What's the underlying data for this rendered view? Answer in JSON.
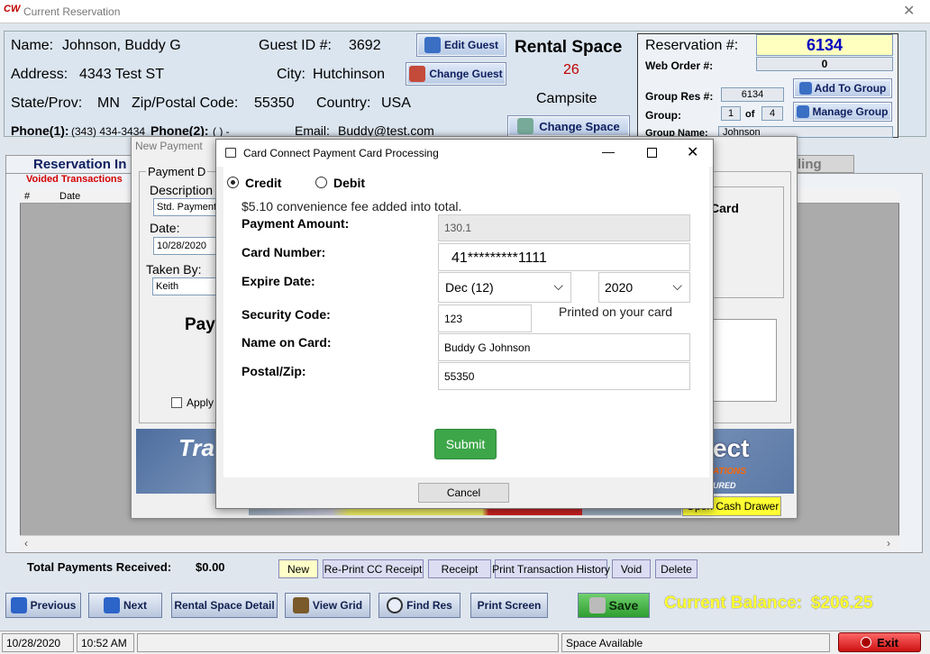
{
  "app": {
    "title": "Current Reservation",
    "logo": "CW"
  },
  "guest": {
    "name_label": "Name:",
    "name_value": "Johnson, Buddy G",
    "guest_id_label": "Guest ID #:",
    "guest_id_value": "3692",
    "address_label": "Address:",
    "address_value": "4343 Test ST",
    "city_label": "City:",
    "city_value": "Hutchinson",
    "state_label": "State/Prov:",
    "state_value": "MN",
    "zip_label": "Zip/Postal Code:",
    "zip_value": "55350",
    "country_label": "Country:",
    "country_value": "USA",
    "phone1_label": "Phone(1):",
    "phone1_value": "(343) 434-3434",
    "phone2_label": "Phone(2):",
    "phone2_value": "(   )      -",
    "email_label": "Email:",
    "email_value": "Buddy@test.com",
    "edit_guest": "Edit Guest",
    "change_guest": "Change Guest"
  },
  "rental": {
    "label": "Rental Space",
    "number": "26",
    "type": "Campsite",
    "change_space": "Change Space"
  },
  "reservation": {
    "res_label": "Reservation #:",
    "res_value": "6134",
    "web_label": "Web Order #:",
    "web_value": "0",
    "group_res_label": "Group Res #:",
    "group_res_value": "6134",
    "group_label": "Group:",
    "group_of_value": "1",
    "group_of_label": "of",
    "group_total": "4",
    "group_name_label": "Group Name:",
    "group_name_value": "Johnson",
    "add_group": "Add To Group",
    "manage_group": "Manage Group"
  },
  "tabs": {
    "reservation_info": "Reservation In",
    "billing": "ling"
  },
  "transactions": {
    "voided": "Voided Transactions",
    "col_num": "#",
    "col_date": "Date",
    "total_label": "Total Payments Received:",
    "total_value": "$0.00",
    "buttons": {
      "new": "New",
      "reprint": "Re-Print CC Receipt",
      "receipt": "Receipt",
      "history": "Print Transaction History",
      "void": "Void",
      "delete": "Delete"
    }
  },
  "new_payment": {
    "title": "New Payment",
    "group_label": "Payment D",
    "desc_label": "Description",
    "desc_value": "Std. Payment",
    "date_label": "Date:",
    "date_value": "10/28/2020",
    "taken_label": "Taken By:",
    "taken_value": "Keith",
    "pay_text": "Pay",
    "apply_label": "Apply e",
    "card_label": "Card",
    "banner_left": "Tra",
    "banner_right": "ect",
    "banner_sub": "ATIONS",
    "banner_sub2": "URED",
    "cash_drawer": "Open Cash Drawer"
  },
  "cc_dialog": {
    "title": "Card Connect Payment Card Processing",
    "credit": "Credit",
    "debit": "Debit",
    "fee_note": "$5.10 convenience fee added into total.",
    "amount_label": "Payment Amount:",
    "amount_value": "130.1",
    "card_label": "Card Number:",
    "card_value": "41*********1111",
    "expire_label": "Expire Date:",
    "expire_month": "Dec (12)",
    "expire_year": "2020",
    "cvv_label": "Security Code:",
    "cvv_value": "123",
    "cvv_hint": "Printed on your card",
    "name_label": "Name on Card:",
    "name_value": "Buddy G Johnson",
    "zip_label": "Postal/Zip:",
    "zip_value": "55350",
    "submit": "Submit",
    "cancel": "Cancel"
  },
  "nav": {
    "previous": "Previous",
    "next": "Next",
    "detail": "Rental Space Detail",
    "grid": "View Grid",
    "find": "Find Res",
    "print": "Print Screen",
    "save": "Save"
  },
  "balance": {
    "label": "Current Balance:",
    "value": "$206.25"
  },
  "status": {
    "date": "10/28/2020",
    "time": "10:52 AM",
    "space": "Space Available",
    "exit": "Exit"
  },
  "colors": {
    "balance": "#ffff33",
    "reservation": "#0000c0",
    "rental_number": "#c00000",
    "submit": "#3ca648",
    "voided": "#d40000"
  }
}
